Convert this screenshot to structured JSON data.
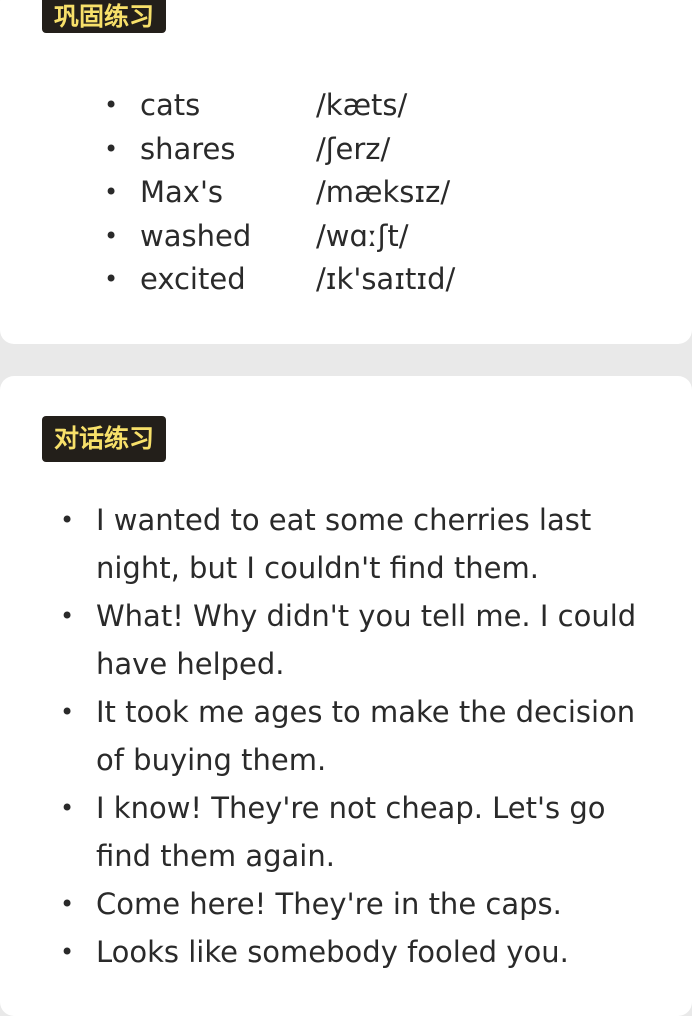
{
  "section_review": {
    "badge": "巩固练习",
    "items": [
      {
        "word": "cats",
        "ipa": "/kæts/"
      },
      {
        "word": "shares",
        "ipa": "/ʃerz/"
      },
      {
        "word": "Max's",
        "ipa": "/mæksɪz/"
      },
      {
        "word": "washed",
        "ipa": "/wɑːʃt/"
      },
      {
        "word": "excited",
        "ipa": "/ɪk'saɪtɪd/"
      }
    ]
  },
  "section_dialogue": {
    "badge": "对话练习",
    "lines": [
      "I wanted to eat some cherries last night, but I couldn't find them.",
      "What! Why didn't you tell me. I could have helped.",
      "It took me ages to make the decision of buying them.",
      "I know! They're not cheap. Let's go find them again.",
      "Come here! They're in the caps.",
      "Looks like somebody fooled you."
    ]
  },
  "colors": {
    "badge_background": "#231f1a",
    "badge_text": "#f7e06a",
    "page_background": "#e9e9e9",
    "card_background": "#ffffff"
  }
}
